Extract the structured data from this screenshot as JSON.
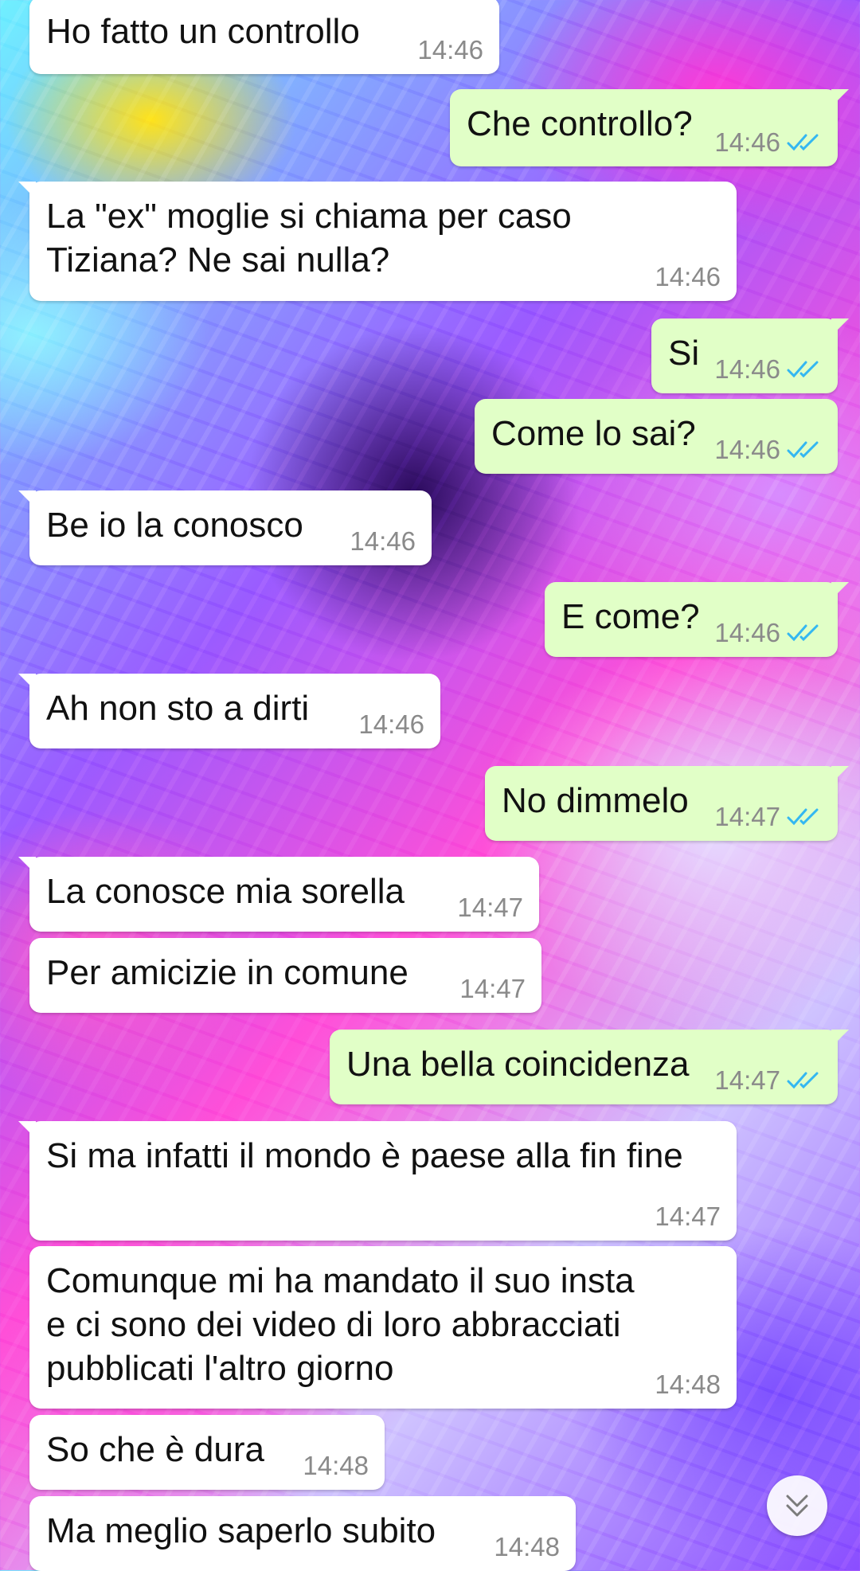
{
  "colors": {
    "incoming_bubble": "#ffffff",
    "outgoing_bubble": "#e1ffc7",
    "timestamp": "#8a8a8a",
    "read_ticks": "#34b7f1"
  },
  "messages": [
    {
      "dir": "in",
      "text": "Ho fatto un controllo",
      "time": "14:46"
    },
    {
      "dir": "out",
      "text": "Che controllo?",
      "time": "14:46",
      "status": "read"
    },
    {
      "dir": "in",
      "text": "La \"ex\" moglie si chiama per caso\nTiziana? Ne sai nulla?",
      "time": "14:46"
    },
    {
      "dir": "out",
      "text": "Si",
      "time": "14:46",
      "status": "read"
    },
    {
      "dir": "out",
      "text": "Come lo sai?",
      "time": "14:46",
      "status": "read"
    },
    {
      "dir": "in",
      "text": "Be io la conosco",
      "time": "14:46"
    },
    {
      "dir": "out",
      "text": "E come?",
      "time": "14:46",
      "status": "read"
    },
    {
      "dir": "in",
      "text": "Ah non sto a dirti",
      "time": "14:46"
    },
    {
      "dir": "out",
      "text": "No dimmelo",
      "time": "14:47",
      "status": "read"
    },
    {
      "dir": "in",
      "text": "La conosce mia sorella",
      "time": "14:47"
    },
    {
      "dir": "in",
      "text": "Per amicizie in comune",
      "time": "14:47"
    },
    {
      "dir": "out",
      "text": "Una bella coincidenza",
      "time": "14:47",
      "status": "read"
    },
    {
      "dir": "in",
      "text": "Si ma infatti il mondo è paese alla fin fine",
      "time": "14:47"
    },
    {
      "dir": "in",
      "text": "Comunque mi ha mandato il suo insta\ne ci sono dei video di loro abbracciati\npubblicati l'altro giorno",
      "time": "14:48"
    },
    {
      "dir": "in",
      "text": "So che è dura",
      "time": "14:48"
    },
    {
      "dir": "in",
      "text": "Ma meglio saperlo subito",
      "time": "14:48"
    }
  ],
  "scroll_button": {
    "icon": "double-chevron-down-icon"
  }
}
